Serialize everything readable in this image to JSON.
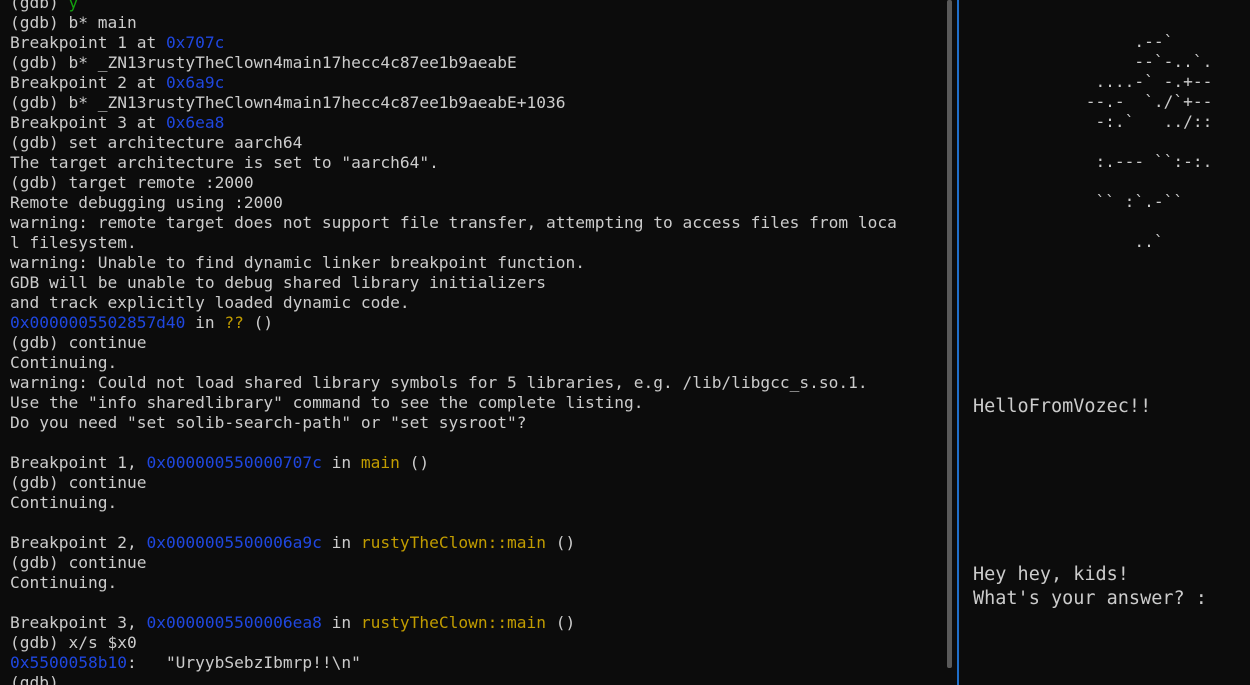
{
  "terminal_left": {
    "lines": [
      [
        {
          "t": "(gdb) ",
          "c": ""
        },
        {
          "t": "y",
          "c": "green"
        }
      ],
      [
        {
          "t": "(gdb) b* main",
          "c": ""
        }
      ],
      [
        {
          "t": "Breakpoint 1 at ",
          "c": ""
        },
        {
          "t": "0x707c",
          "c": "blue"
        }
      ],
      [
        {
          "t": "(gdb) b* _ZN13rustyTheClown4main17hecc4c87ee1b9aeabE",
          "c": ""
        }
      ],
      [
        {
          "t": "Breakpoint 2 at ",
          "c": ""
        },
        {
          "t": "0x6a9c",
          "c": "blue"
        }
      ],
      [
        {
          "t": "(gdb) b* _ZN13rustyTheClown4main17hecc4c87ee1b9aeabE+1036",
          "c": ""
        }
      ],
      [
        {
          "t": "Breakpoint 3 at ",
          "c": ""
        },
        {
          "t": "0x6ea8",
          "c": "blue"
        }
      ],
      [
        {
          "t": "(gdb) set architecture aarch64",
          "c": ""
        }
      ],
      [
        {
          "t": "The target architecture is set to \"aarch64\".",
          "c": ""
        }
      ],
      [
        {
          "t": "(gdb) target remote :2000",
          "c": ""
        }
      ],
      [
        {
          "t": "Remote debugging using :2000",
          "c": ""
        }
      ],
      [
        {
          "t": "warning: remote target does not support file transfer, attempting to access files from loca",
          "c": ""
        }
      ],
      [
        {
          "t": "l filesystem.",
          "c": ""
        }
      ],
      [
        {
          "t": "warning: Unable to find dynamic linker breakpoint function.",
          "c": ""
        }
      ],
      [
        {
          "t": "GDB will be unable to debug shared library initializers",
          "c": ""
        }
      ],
      [
        {
          "t": "and track explicitly loaded dynamic code.",
          "c": ""
        }
      ],
      [
        {
          "t": "0x0000005502857d40",
          "c": "blue"
        },
        {
          "t": " in ",
          "c": ""
        },
        {
          "t": "??",
          "c": "yellow"
        },
        {
          "t": " ()",
          "c": ""
        }
      ],
      [
        {
          "t": "(gdb) continue",
          "c": ""
        }
      ],
      [
        {
          "t": "Continuing.",
          "c": ""
        }
      ],
      [
        {
          "t": "warning: Could not load shared library symbols for 5 libraries, e.g. /lib/libgcc_s.so.1.",
          "c": ""
        }
      ],
      [
        {
          "t": "Use the \"info sharedlibrary\" command to see the complete listing.",
          "c": ""
        }
      ],
      [
        {
          "t": "Do you need \"set solib-search-path\" or \"set sysroot\"?",
          "c": ""
        }
      ],
      [
        {
          "t": "",
          "c": ""
        }
      ],
      [
        {
          "t": "Breakpoint 1, ",
          "c": ""
        },
        {
          "t": "0x000000550000707c",
          "c": "blue"
        },
        {
          "t": " in ",
          "c": ""
        },
        {
          "t": "main",
          "c": "yellow2"
        },
        {
          "t": " ()",
          "c": ""
        }
      ],
      [
        {
          "t": "(gdb) continue",
          "c": ""
        }
      ],
      [
        {
          "t": "Continuing.",
          "c": ""
        }
      ],
      [
        {
          "t": "",
          "c": ""
        }
      ],
      [
        {
          "t": "Breakpoint 2, ",
          "c": ""
        },
        {
          "t": "0x0000005500006a9c",
          "c": "blue"
        },
        {
          "t": " in ",
          "c": ""
        },
        {
          "t": "rustyTheClown::main",
          "c": "yellow2"
        },
        {
          "t": " ()",
          "c": ""
        }
      ],
      [
        {
          "t": "(gdb) continue",
          "c": ""
        }
      ],
      [
        {
          "t": "Continuing.",
          "c": ""
        }
      ],
      [
        {
          "t": "",
          "c": ""
        }
      ],
      [
        {
          "t": "Breakpoint 3, ",
          "c": ""
        },
        {
          "t": "0x0000005500006ea8",
          "c": "blue"
        },
        {
          "t": " in ",
          "c": ""
        },
        {
          "t": "rustyTheClown::main",
          "c": "yellow2"
        },
        {
          "t": " ()",
          "c": ""
        }
      ],
      [
        {
          "t": "(gdb) x/s $x0",
          "c": ""
        }
      ],
      [
        {
          "t": "0x5500058b10",
          "c": "blue"
        },
        {
          "t": ":\t\"UryybSebzIbmrp!!\\n\"",
          "c": ""
        }
      ],
      [
        {
          "t": "(gdb) ",
          "c": ""
        }
      ]
    ]
  },
  "terminal_right": {
    "art_lines": [
      "                  .--`",
      "                  --`-..`.",
      "              ....-` -.+--",
      "             --.-  `./`+--",
      "              -:.`   ../::",
      "",
      "              :.--- ``:-:.",
      "",
      "              `` :`.-``",
      "",
      "                  ..`"
    ],
    "hello": "HelloFromVozec!!",
    "prompt_line1": "Hey hey, kids!",
    "prompt_line2": "What's your answer? :"
  },
  "colors": {
    "background": "#0c0c0c",
    "text": "#cccccc",
    "blue": "#1f47e0",
    "yellow": "#c19c00",
    "green": "#13a10e",
    "divider": "#1f6ec9"
  }
}
